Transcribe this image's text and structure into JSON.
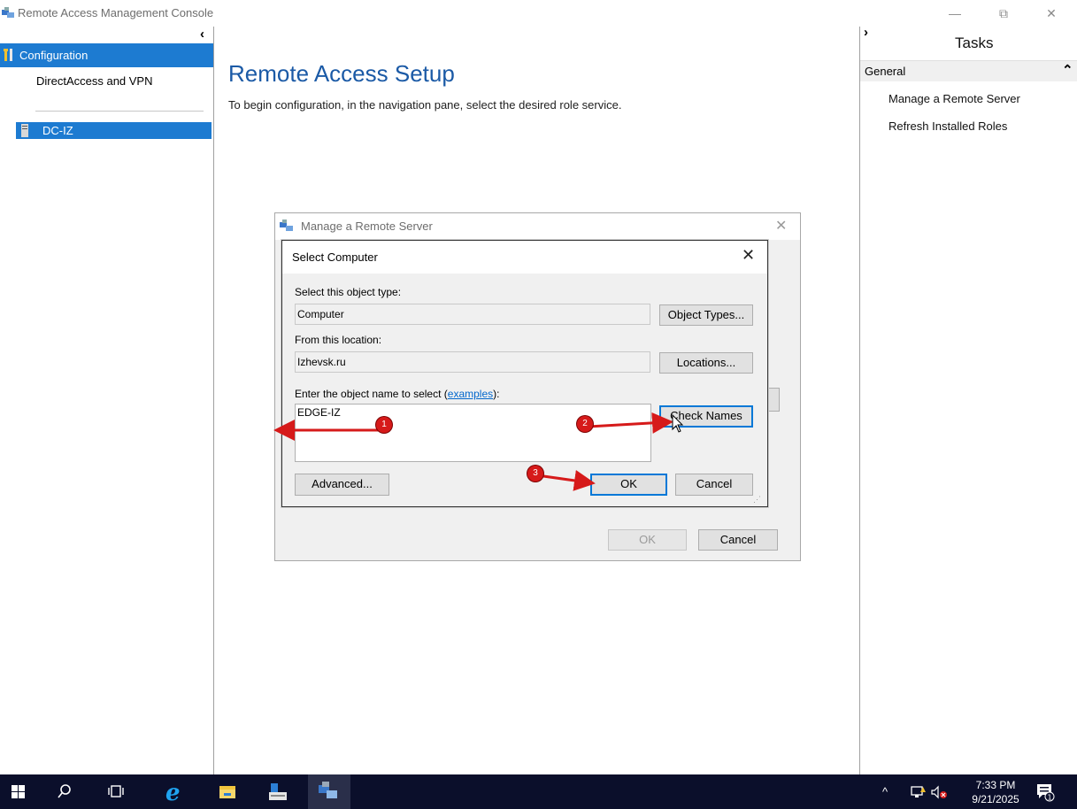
{
  "window": {
    "title": "Remote Access Management Console",
    "minimize_glyph": "—",
    "restore_glyph": "⧉",
    "close_glyph": "✕"
  },
  "nav": {
    "collapse_glyph": "‹",
    "configuration_label": "Configuration",
    "directaccess_label": "DirectAccess and VPN",
    "server_label": "DC-IZ"
  },
  "main": {
    "title": "Remote Access Setup",
    "description": "To begin configuration, in the navigation pane, select the desired role service."
  },
  "tasks": {
    "expand_glyph": "›",
    "title": "Tasks",
    "section_label": "General",
    "section_chevron": "⌃",
    "items": [
      {
        "label": "Manage a Remote Server"
      },
      {
        "label": "Refresh Installed Roles"
      }
    ]
  },
  "manage_dialog": {
    "title": "Manage a Remote Server",
    "close_glyph": "✕",
    "ok_label": "OK",
    "cancel_label": "Cancel"
  },
  "select_dialog": {
    "title": "Select Computer",
    "close_glyph": "✕",
    "object_type_label": "Select this object type:",
    "object_type_value": "Computer",
    "object_types_button": "Object Types...",
    "location_label": "From this location:",
    "location_value": "Izhevsk.ru",
    "locations_button": "Locations...",
    "enter_name_label_prefix": "Enter the object name to select (",
    "examples_link": "examples",
    "enter_name_label_suffix": "):",
    "object_name_value": "EDGE-IZ",
    "check_names_button": "Check Names",
    "advanced_button": "Advanced...",
    "ok_button": "OK",
    "cancel_button": "Cancel"
  },
  "annotations": {
    "step1": "1",
    "step2": "2",
    "step3": "3",
    "arrow_color": "#d61a1a"
  },
  "taskbar": {
    "icons": [
      "windows-start-icon",
      "search-icon",
      "task-view-icon",
      "internet-explorer-icon",
      "file-explorer-icon",
      "server-manager-icon",
      "remote-access-console-icon"
    ],
    "tray_chevron": "^",
    "time": "7:33 PM",
    "date": "9/21/2025",
    "notification_count": "1"
  },
  "colors": {
    "selection_blue": "#1d7bd1",
    "heading_blue": "#1b5aa6",
    "taskbar_bg": "#0b0f2b",
    "default_button_border": "#0078d7"
  }
}
